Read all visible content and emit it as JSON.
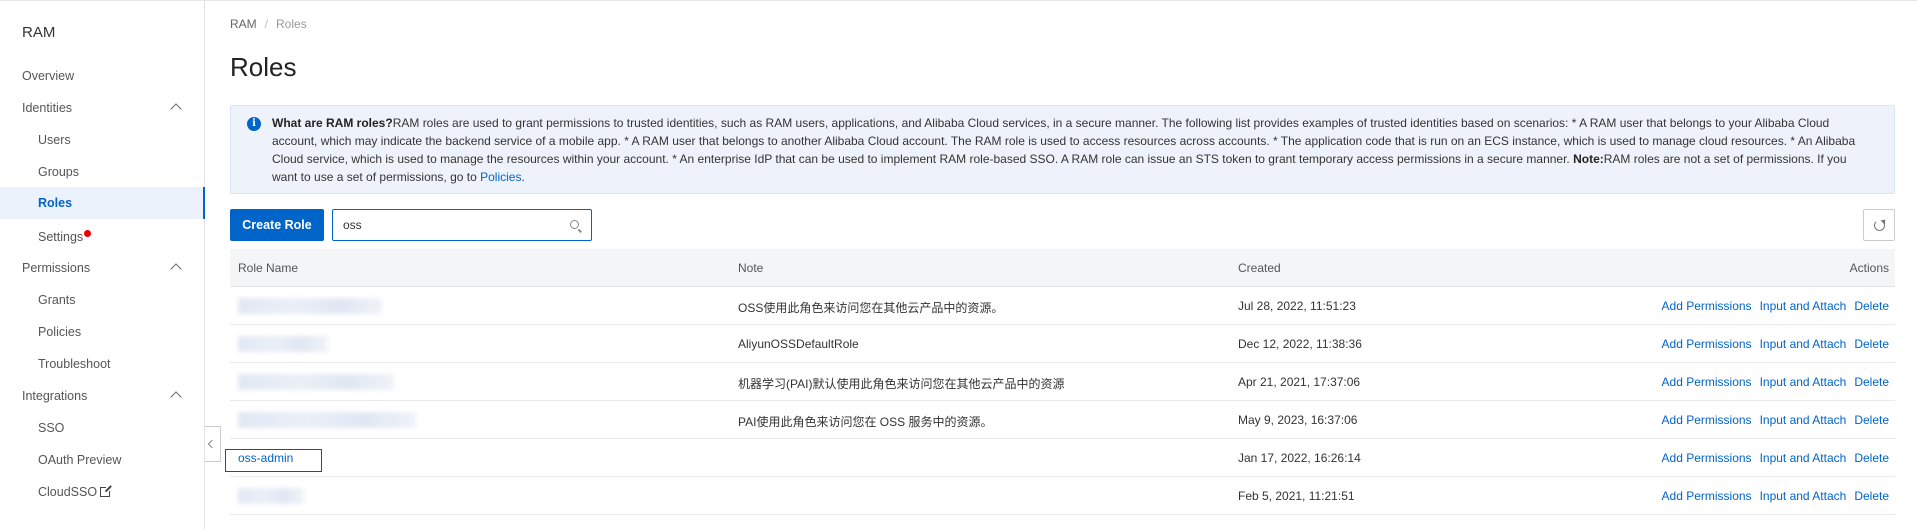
{
  "sidebar": {
    "brand": "RAM",
    "items": [
      {
        "label": "Overview"
      },
      {
        "label": "Identities"
      },
      {
        "label": "Users"
      },
      {
        "label": "Groups"
      },
      {
        "label": "Roles"
      },
      {
        "label": "Settings"
      },
      {
        "label": "Permissions"
      },
      {
        "label": "Grants"
      },
      {
        "label": "Policies"
      },
      {
        "label": "Troubleshoot"
      },
      {
        "label": "Integrations"
      },
      {
        "label": "SSO"
      },
      {
        "label": "OAuth Preview"
      },
      {
        "label": "CloudSSO"
      }
    ]
  },
  "breadcrumb": {
    "root": "RAM",
    "sep": "/",
    "current": "Roles"
  },
  "page_title": "Roles",
  "info": {
    "bold_title": "What are RAM roles?",
    "text": "RAM roles are used to grant permissions to trusted identities, such as RAM users, applications, and Alibaba Cloud services, in a secure manner. The following list provides examples of trusted identities based on scenarios: * A RAM user that belongs to your Alibaba Cloud account, which may indicate the backend service of a mobile app. * A RAM user that belongs to another Alibaba Cloud account. The RAM role is used to access resources across accounts. * The application code that is run on an ECS instance, which is used to manage cloud resources. * An Alibaba Cloud service, which is used to manage the resources within your account. * An enterprise IdP that can be used to implement RAM role-based SSO. A RAM role can issue an STS token to grant temporary access permissions in a secure manner. ",
    "note_label": "Note:",
    "note_text": "RAM roles are not a set of permissions. If you want to use a set of permissions, go to ",
    "link": "Policies",
    "end": "."
  },
  "toolbar": {
    "create_label": "Create Role",
    "search_value": "oss"
  },
  "table": {
    "headers": {
      "role_name": "Role Name",
      "note": "Note",
      "created": "Created",
      "actions": "Actions"
    },
    "actions": {
      "add": "Add Permissions",
      "input": "Input and Attach",
      "delete": "Delete"
    },
    "rows": [
      {
        "role_name": "",
        "note": "OSS使用此角色来访问您在其他云产品中的资源。",
        "created": "Jul 28, 2022, 11:51:23"
      },
      {
        "role_name": "",
        "note": "AliyunOSSDefaultRole",
        "created": "Dec 12, 2022, 11:38:36"
      },
      {
        "role_name": "",
        "note": "机器学习(PAI)默认使用此角色来访问您在其他云产品中的资源",
        "created": "Apr 21, 2021, 17:37:06"
      },
      {
        "role_name": "",
        "note": "PAI使用此角色来访问您在 OSS 服务中的资源。",
        "created": "May 9, 2023, 16:37:06"
      },
      {
        "role_name": "oss-admin",
        "note": "",
        "created": "Jan 17, 2022, 16:26:14"
      },
      {
        "role_name": "",
        "note": "",
        "created": "Feb 5, 2021, 11:21:51"
      }
    ]
  },
  "colors": {
    "accent": "#0064c8",
    "highlight": "#e00000"
  }
}
